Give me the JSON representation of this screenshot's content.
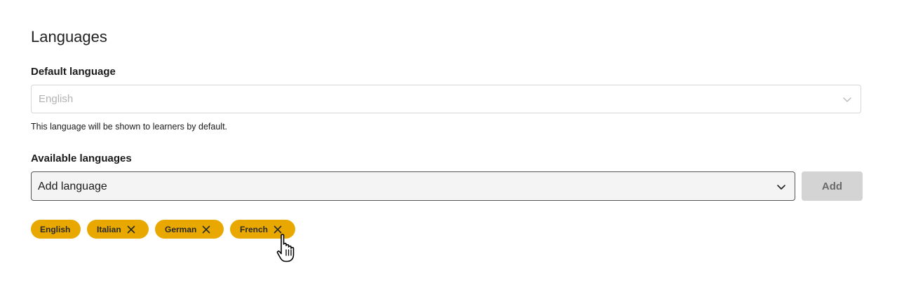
{
  "section": {
    "title": "Languages"
  },
  "default_language": {
    "label": "Default language",
    "placeholder": "English",
    "help_text": "This language will be shown to learners by default."
  },
  "available_languages": {
    "label": "Available languages",
    "select_value": "Add language",
    "add_button": "Add",
    "tags": [
      {
        "label": "English",
        "removable": false
      },
      {
        "label": "Italian",
        "removable": true
      },
      {
        "label": "German",
        "removable": true
      },
      {
        "label": "French",
        "removable": true
      }
    ]
  },
  "colors": {
    "tag_background": "#e8a800",
    "add_button_background": "#d4d4d4",
    "add_button_text": "#6b6b6b",
    "placeholder_text": "#b3b3b3"
  },
  "icons": {
    "select_chevron": "chevron-down-icon",
    "tag_remove": "close-icon",
    "pointer": "hand-pointer-cursor-icon"
  }
}
